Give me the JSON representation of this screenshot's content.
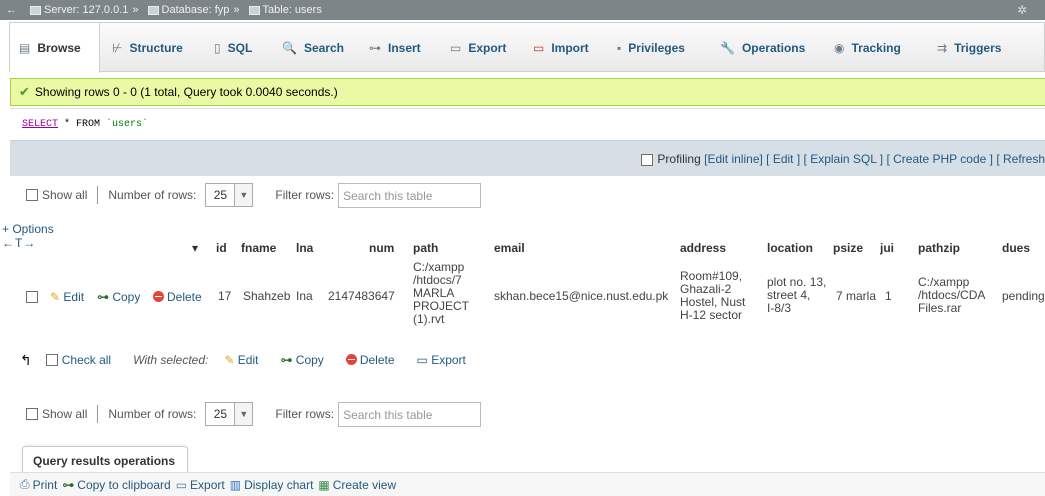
{
  "titlebar": {
    "back": "←",
    "server": "Server: 127.0.0.1",
    "database": "Database: fyp",
    "table": "Table: users",
    "sep": "»"
  },
  "tabs": [
    {
      "label": "Browse",
      "icon": "▤"
    },
    {
      "label": "Structure",
      "icon": "⊬"
    },
    {
      "label": "SQL",
      "icon": "▯"
    },
    {
      "label": "Search",
      "icon": "🔍"
    },
    {
      "label": "Insert",
      "icon": "⊶"
    },
    {
      "label": "Export",
      "icon": "▭"
    },
    {
      "label": "Import",
      "icon": "▭"
    },
    {
      "label": "Privileges",
      "icon": "▪"
    },
    {
      "label": "Operations",
      "icon": "🔧"
    },
    {
      "label": "Tracking",
      "icon": "◉"
    },
    {
      "label": "Triggers",
      "icon": "⇉"
    }
  ],
  "message": "Showing rows 0 - 0 (1 total, Query took 0.0040 seconds.)",
  "sql": {
    "select": "SELECT",
    "mid": " * FROM ",
    "table": "`users`"
  },
  "tools": {
    "profiling": "Profiling",
    "edit_inline": "[Edit inline]",
    "edit": "[ Edit ]",
    "explain": "[ Explain SQL ]",
    "php": "[ Create PHP code ]",
    "refresh": "[ Refresh"
  },
  "nav": {
    "show_all": "Show all",
    "number_of_rows": "Number of rows:",
    "rows_value": "25",
    "filter_rows": "Filter rows:",
    "filter_placeholder": "Search this table"
  },
  "options": "+ Options",
  "col_arrows": "←T→",
  "columns": [
    "id",
    "fname",
    "lna",
    "num",
    "path",
    "email",
    "address",
    "location",
    "psize",
    "jui",
    "pathzip",
    "dues"
  ],
  "row": {
    "edit": "Edit",
    "copy": "Copy",
    "delete": "Delete",
    "id": "17",
    "fname": "Shahzeb",
    "lname": "Ina",
    "num": "2147483647",
    "path": [
      "C:/xampp",
      "/htdocs/7",
      "MARLA",
      "PROJECT",
      "(1).rvt"
    ],
    "email": "skhan.bece15@nice.nust.edu.pk",
    "address": [
      "Room#109,",
      "Ghazali-2",
      "Hostel, Nust",
      "H-12 sector"
    ],
    "location": [
      "plot no. 13,",
      "street 4,",
      "I-8/3"
    ],
    "psize": "7 marla",
    "jui": "1",
    "pathzip": [
      "C:/xampp",
      "/htdocs/CDA",
      "Files.rar"
    ],
    "dues": "pending"
  },
  "bulk": {
    "check_all": "Check all",
    "with_selected": "With selected:",
    "edit": "Edit",
    "copy": "Copy",
    "delete": "Delete",
    "export": "Export"
  },
  "qro": {
    "title": "Query results operations",
    "print": "Print",
    "copy_clip": "Copy to clipboard",
    "export": "Export",
    "display_chart": "Display chart",
    "create_view": "Create view"
  }
}
